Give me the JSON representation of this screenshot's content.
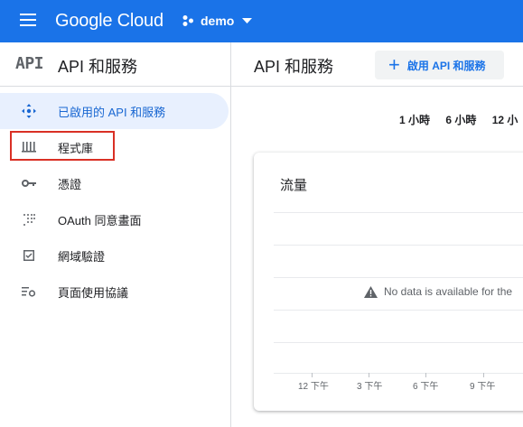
{
  "topbar": {
    "logo": "Google Cloud",
    "project": "demo",
    "color": "#1a73e8"
  },
  "sidebar": {
    "title": "API 和服務",
    "api_glyph": "API",
    "items": [
      {
        "label": "已啟用的 API 和服務",
        "icon": "move-icon",
        "active": true
      },
      {
        "label": "程式庫",
        "icon": "library-icon",
        "active": false
      },
      {
        "label": "憑證",
        "icon": "key-icon",
        "active": false
      },
      {
        "label": "OAuth 同意畫面",
        "icon": "dots-grid-icon",
        "active": false
      },
      {
        "label": "網域驗證",
        "icon": "checkbox-icon",
        "active": false
      },
      {
        "label": "頁面使用協議",
        "icon": "settings-list-icon",
        "active": false
      }
    ],
    "highlight_color": "#d93025"
  },
  "main": {
    "title": "API 和服務",
    "enable_button": "啟用 API 和服務",
    "time_ranges": [
      "1 小時",
      "6 小時",
      "12 小"
    ],
    "card": {
      "title": "流量",
      "no_data": "No data is available for the",
      "x_ticks": [
        "12 下午",
        "3 下午",
        "6 下午",
        "9 下午"
      ]
    }
  }
}
